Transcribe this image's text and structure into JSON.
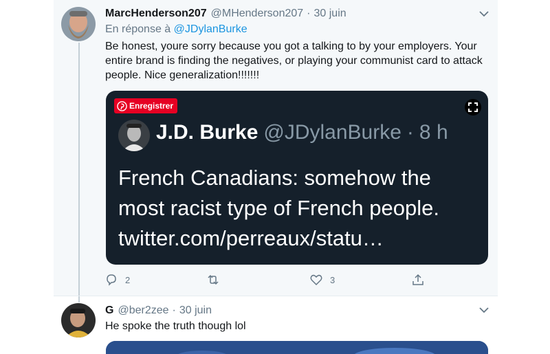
{
  "tweet1": {
    "display_name": "MarcHenderson207",
    "handle": "@MHenderson207",
    "separator": "·",
    "date": "30 juin",
    "reply_prefix": "En réponse à",
    "reply_mention": "@JDylanBurke",
    "text": "Be honest, youre sorry because you got a talking to by your employers. Your entire brand is finding the negatives, or playing your communist card to attack people. Nice generalization!!!!!!!",
    "media": {
      "save_button_label": "Enregistrer",
      "embedded_name": "J.D. Burke",
      "embedded_handle": "@JDylanBurke",
      "embedded_separator": "·",
      "embedded_time": "8 h",
      "embedded_text": "French Canadians: somehow the most racist type of French people. twitter.com/perreaux/statu…"
    },
    "actions": {
      "reply_count": "2",
      "retweet_count": "",
      "like_count": "3"
    }
  },
  "tweet2": {
    "display_name": "G",
    "handle": "@ber2zee",
    "separator": "·",
    "date": "30 juin",
    "text": "He spoke the truth though lol"
  },
  "colors": {
    "link": "#1b95e0",
    "secondary_text": "#657786",
    "card_background": "#15202b",
    "pinterest_red": "#e60023",
    "highlight_background": "#f5f8fa"
  },
  "icons": [
    "chevron-down-icon",
    "pinterest-icon",
    "expand-icon",
    "reply-icon",
    "retweet-icon",
    "like-icon",
    "share-icon"
  ]
}
